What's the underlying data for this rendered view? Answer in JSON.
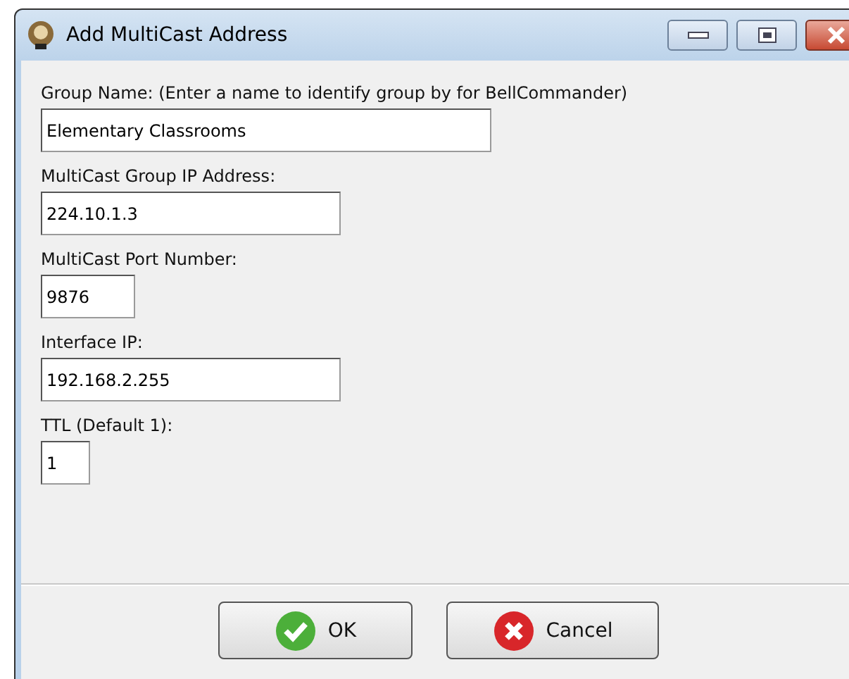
{
  "window": {
    "title": "Add MultiCast Address"
  },
  "fields": [
    {
      "label": "Group Name: (Enter a name to identify group by for BellCommander)",
      "value": "Elementary Classrooms"
    },
    {
      "label": "MultiCast Group IP Address:",
      "value": "224.10.1.3"
    },
    {
      "label": "MultiCast Port Number:",
      "value": "9876"
    },
    {
      "label": "Interface IP:",
      "value": "192.168.2.255"
    },
    {
      "label": "TTL (Default 1):",
      "value": "1"
    }
  ],
  "buttons": [
    {
      "label": "OK",
      "kind": "ok"
    },
    {
      "label": "Cancel",
      "kind": "cancel"
    }
  ]
}
